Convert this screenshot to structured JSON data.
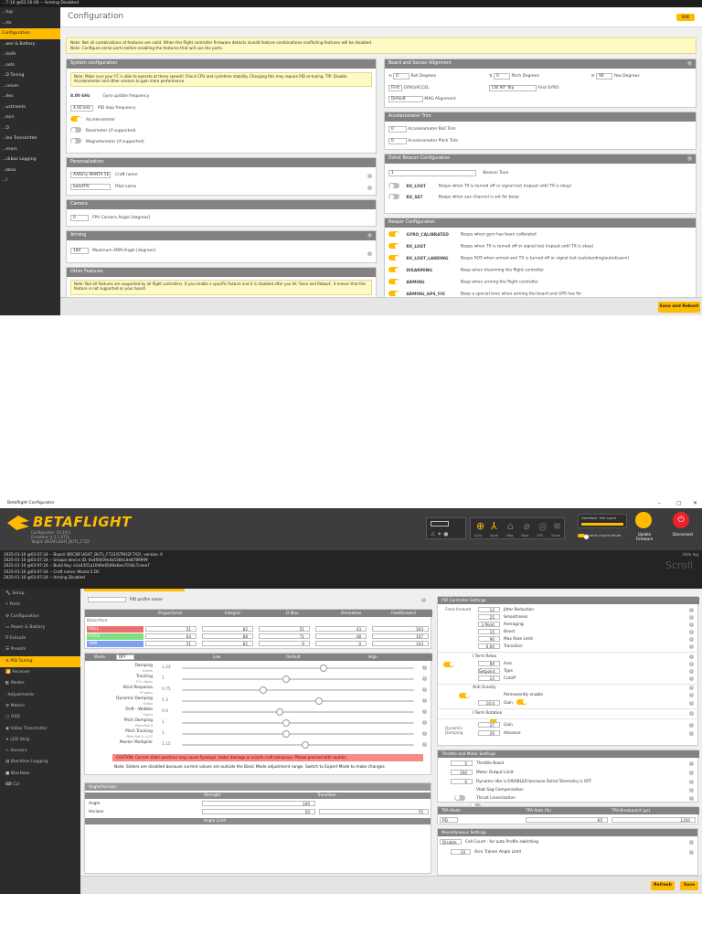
{
  "top": {
    "titlebar": "...7-10 @02:16:06 -- Arming Disabled",
    "sidebar": [
      "...tup",
      "...rts",
      "Configuration",
      "...wer & Battery",
      "...lsafe",
      "...sets",
      "...D Tuning",
      "...ceiver",
      "...des",
      "...ustments",
      "...tors",
      "...D",
      "...leo Transmitter",
      "...nsors",
      "...ckbox Logging",
      "...kbox",
      "...I"
    ],
    "page_title": "Configuration",
    "wiki_label": "WIKI",
    "note_line1": "Note: Not all combinations of features are valid. When the flight controller firmware detects invalid feature combinations conflicting features will be disabled.",
    "note_line2": "Note: Configure serial ports before enabling the features that will use the ports.",
    "system": {
      "title": "System configuration",
      "note": "Note: Make sure your FC is able to operate at these speeds! Check CPU and cycletime stability. Changing this may require PID re-tuning. TIP: Disable Accelerometer and other sensors to gain more performance.",
      "gyro_freq_value": "8.00 kHz",
      "gyro_freq_label": "Gyro update frequency",
      "pid_freq_value": "4.00 kHz",
      "pid_freq_label": "PID loop frequency",
      "accel": "Accelerometer",
      "baro": "Barometer (if supported)",
      "mag": "Magnetometer (if supported)"
    },
    "personal": {
      "title": "Personalization",
      "craft_value": "AXISFly MANTA 5E",
      "craft_label": "Craft name",
      "pilot_value": "betaFPV",
      "pilot_label": "Pilot name"
    },
    "camera": {
      "title": "Camera",
      "value": "0",
      "label": "FPV Camera Angle [degrees]"
    },
    "arming": {
      "title": "Arming",
      "value": "180",
      "label": "Maximum ARM Angle [degrees]"
    },
    "other": {
      "title": "Other Features",
      "note": "Note: Not all features are supported by all flight controllers. If you enable a specific feature and it is disabled after you hit 'Save and Reboot', it means that this feature is not supported on your board."
    },
    "board": {
      "title": "Board and Sensor Alignment",
      "roll_value": "0",
      "roll_label": "Roll Degrees",
      "pitch_value": "0",
      "pitch_label": "Pitch Degrees",
      "yaw_value": "90",
      "yaw_label": "Yaw Degrees",
      "gyro_sel": "First",
      "gyro_label": "GYRO/ACCEL",
      "align_sel": "CW 90° flip",
      "align_label": "First GYRO",
      "mag_sel": "Default",
      "mag_label": "MAG Alignment"
    },
    "acc_trim": {
      "title": "Accelerometer Trim",
      "roll_value": "0",
      "roll_label": "Accelerometer Roll Trim",
      "pitch_value": "0",
      "pitch_label": "Accelerometer Pitch Trim"
    },
    "dshot": {
      "title": "Dshot Beacon Configuration",
      "tone_value": "1",
      "tone_label": "Beacon Tone",
      "rows": [
        {
          "name": "RX_LOST",
          "desc": "Beeps when TX is turned off or signal lost (repeat until TX is okay)"
        },
        {
          "name": "RX_SET",
          "desc": "Beeps when aux channel is set for beep"
        }
      ]
    },
    "beeper": {
      "title": "Beeper Configuration",
      "rows": [
        {
          "name": "GYRO_CALIBRATED",
          "desc": "Beeps when gyro has been calibrated",
          "on": true
        },
        {
          "name": "RX_LOST",
          "desc": "Beeps when TX is turned off or signal lost (repeat until TX is okay)",
          "on": true
        },
        {
          "name": "RX_LOST_LANDING",
          "desc": "Beeps SOS when armed and TX is turned off or signal lost (autolanding/autodisarm)",
          "on": true
        },
        {
          "name": "DISARMING",
          "desc": "Beep when disarming the flight controller",
          "on": true
        },
        {
          "name": "ARMING",
          "desc": "Beep when arming the flight controller",
          "on": true
        },
        {
          "name": "ARMING_GPS_FIX",
          "desc": "Beep a special tone when arming the board and GPS has fix",
          "on": true
        }
      ]
    },
    "save_reboot": "Save and Reboot"
  },
  "bottom": {
    "window_title": "Betaflight Configurator",
    "win_controls": [
      "–",
      "▢",
      "✕"
    ],
    "logo": "BETAFLIGHT",
    "logo_sub1": "Configurator: 10.10.0",
    "logo_sub2": "Firmware: 4.5.1 BTFL",
    "logo_sub3": "Target: BETAFLIGHT_BUTL_F722",
    "sensors": [
      "Gyro",
      "Accel",
      "Mag",
      "Baro",
      "GPS",
      "Sonar"
    ],
    "dataflash": "Dataflash: free space",
    "expert_label": "Enable Expert Mode",
    "update_fw": "Update Firmware",
    "disconnect": "Disconnect",
    "hide_log": "Hide log",
    "scroll": "Scroll",
    "log": [
      "2025-01-10 @03:07:24 -- Board: BRC/BFLIGHT_BUTL_F722(STM32F7X2), version: 0",
      "2025-01-10 @03:07:24 -- Unique device ID: 0x4f0059e4a530b1de8789999",
      "2025-01-10 @03:07:24 -- Build Key: e1e4351a10d9e05d9a0ee7016c7ceee7",
      "2025-01-10 @03:07:24 -- Craft name: Manta 5 DC",
      "2025-01-10 @03:07:24 -- Arming Disabled"
    ],
    "sidebar": [
      "Setup",
      "Ports",
      "Configuration",
      "Power & Battery",
      "Failsafe",
      "Presets",
      "PID Tuning",
      "Receiver",
      "Modes",
      "Adjustments",
      "Motors",
      "OSD",
      "Video Transmitter",
      "LED Strip",
      "Sensors",
      "Blackbox Logging",
      "Blackbox",
      "CLI"
    ],
    "sidebar_icons": [
      "wrench-icon",
      "plug-icon",
      "gear-icon",
      "battery-icon",
      "shield-icon",
      "list-icon",
      "sliders-icon",
      "antenna-icon",
      "toggle-icon",
      "adjust-icon",
      "motor-icon",
      "screen-icon",
      "video-icon",
      "light-icon",
      "sensor-icon",
      "log-icon",
      "box-icon",
      "terminal-icon"
    ],
    "profile_name_label": "PID profile name",
    "pid_table": {
      "headers": [
        "Proportional",
        "Integral",
        "D Max",
        "Derivative",
        "Feedforward"
      ],
      "basic_label": "Basic/Acro",
      "rows": [
        {
          "name": "ROLL",
          "color": "#ef6f6f",
          "values": [
            "51",
            "82",
            "51",
            "43",
            "103"
          ]
        },
        {
          "name": "PITCH",
          "color": "#7ee07e",
          "values": [
            "64",
            "88",
            "71",
            "48",
            "107"
          ]
        },
        {
          "name": "YAW",
          "color": "#7f9fef",
          "values": [
            "51",
            "82",
            "0",
            "0",
            "103"
          ]
        }
      ]
    },
    "sliders": {
      "mode_label": "Mode:",
      "mode_value": "OFF",
      "headers": [
        "Low",
        "Default",
        "High"
      ],
      "rows": [
        {
          "label": "Damping",
          "sub": "d-term",
          "value": "1.23",
          "pos": 0.61
        },
        {
          "label": "Tracking",
          "sub": "P & I Gains",
          "value": "1",
          "pos": 0.45
        },
        {
          "label": "Stick Response",
          "sub": "FF gains",
          "value": "0.75",
          "pos": 0.35
        },
        {
          "label": "Dynamic Damping",
          "sub": "D Max",
          "value": "1.3",
          "pos": 0.59
        },
        {
          "label": "Drift - Wobble",
          "sub": "I Gains",
          "value": "0.9",
          "pos": 0.42
        },
        {
          "label": "Pitch Damping",
          "sub": "Pitch:Roll D",
          "value": "1",
          "pos": 0.45
        },
        {
          "label": "Pitch Tracking",
          "sub": "Pitch:Roll P,I & FF",
          "value": "1",
          "pos": 0.45
        },
        {
          "label": "Master Multiplier",
          "sub": "",
          "value": "1.15",
          "pos": 0.53
        }
      ],
      "caution": "CAUTION: Current slider positions may cause flyaways, motor damage or unsafe craft behaviour. Please proceed with caution.",
      "note": "Note: Sliders are disabled because current values are outside the Basic Mode adjustment range. Switch to Expert Mode to make changes."
    },
    "angle": {
      "title": "Angle/Horizon",
      "headers": [
        "Strength",
        "Transition"
      ],
      "rows": [
        {
          "name": "Angle",
          "strength": "100"
        },
        {
          "name": "Horizon",
          "strength": "50",
          "transition": "75"
        }
      ],
      "limit_label": "Angle Limit"
    },
    "pid_ctrl": {
      "title": "PID Controller Settings",
      "ff_label": "Feed-forward",
      "ff_rows": [
        {
          "value": "12",
          "label": "Jitter Reduction"
        },
        {
          "value": "25",
          "label": "Smoothness"
        },
        {
          "value": "3 Point",
          "label": "Averaging"
        },
        {
          "value": "15",
          "label": "Boost"
        },
        {
          "value": "90",
          "label": "Max Rate Limit"
        },
        {
          "value": "0.00",
          "label": "Transition"
        }
      ],
      "iterm_relax": "I Term Relax",
      "relax_rows": [
        {
          "value": "RP",
          "label": "Axis"
        },
        {
          "value": "Setpoint",
          "label": "Type"
        },
        {
          "value": "15",
          "label": "Cutoff"
        }
      ],
      "anti_gravity": "Anti Gravity",
      "perm_label": "Permanently enable",
      "gain_value": "10.0",
      "gain_label": "Gain",
      "iterm_rot": "I Term Rotation",
      "dyn_damp": "Dynamic Damping",
      "dyn_rows": [
        {
          "value": "37",
          "label": "Gain"
        },
        {
          "value": "20",
          "label": "Advance"
        }
      ]
    },
    "throttle": {
      "title": "Throttle and Motor Settings",
      "rows": [
        {
          "value": "5",
          "label": "Throttle Boost"
        },
        {
          "value": "100",
          "label": "Motor Output Limit"
        },
        {
          "value": "0",
          "label": "Dynamic Idle is DISABLED because Dshot Telemetry is OFF"
        }
      ],
      "vbat": "Vbat Sag Compensation",
      "linear": "Thrust Linearization"
    },
    "tpa": {
      "mode_h": "TPA Mode",
      "rate_h": "TPA Rate (%)",
      "bp_h": "TPA Breakpoint (µs)",
      "mode": "PD",
      "rate": "65",
      "bp": "1350"
    },
    "misc": {
      "title": "Miscellaneous Settings",
      "sel": "Disable",
      "label": "Cell Count - for auto Profile switching",
      "limit_value": "10",
      "limit_label": "Acro Trainer Angle Limit"
    },
    "refresh": "Refresh",
    "save": "Save"
  }
}
